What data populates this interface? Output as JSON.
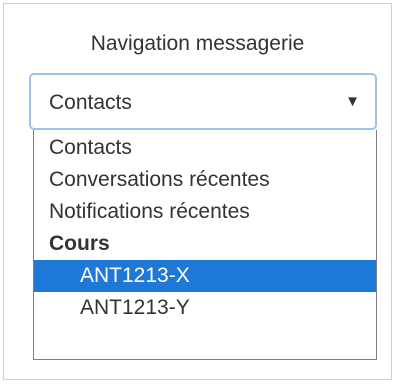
{
  "title": "Navigation messagerie",
  "select": {
    "value": "Contacts",
    "caret": "▼"
  },
  "options": [
    {
      "label": "Contacts",
      "type": "option"
    },
    {
      "label": "Conversations récentes",
      "type": "option"
    },
    {
      "label": "Notifications récentes",
      "type": "option"
    },
    {
      "label": "Cours",
      "type": "group"
    },
    {
      "label": "ANT1213-X",
      "type": "child",
      "selected": true
    },
    {
      "label": "ANT1213-Y",
      "type": "child"
    }
  ],
  "colors": {
    "selected_bg": "#1e78d7",
    "select_focus_border": "#9ec2e6"
  }
}
